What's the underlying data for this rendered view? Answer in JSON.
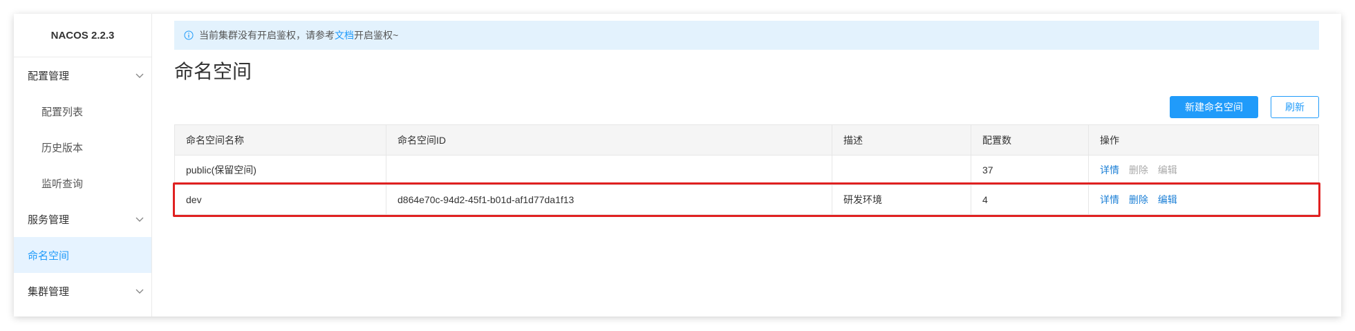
{
  "app": {
    "brand": "NACOS 2.2.3"
  },
  "sidebar": {
    "items": [
      {
        "label": "配置管理",
        "type": "group"
      },
      {
        "label": "配置列表",
        "type": "sub"
      },
      {
        "label": "历史版本",
        "type": "sub"
      },
      {
        "label": "监听查询",
        "type": "sub"
      },
      {
        "label": "服务管理",
        "type": "group"
      },
      {
        "label": "命名空间",
        "type": "active"
      },
      {
        "label": "集群管理",
        "type": "group"
      }
    ]
  },
  "notice": {
    "prefix": "当前集群没有开启鉴权，请参考",
    "link": "文档",
    "suffix": "开启鉴权~"
  },
  "page": {
    "title": "命名空间"
  },
  "toolbar": {
    "create_label": "新建命名空间",
    "refresh_label": "刷新"
  },
  "table": {
    "headers": [
      "命名空间名称",
      "命名空间ID",
      "描述",
      "配置数",
      "操作"
    ],
    "rows": [
      {
        "name": "public(保留空间)",
        "id": "",
        "desc": "",
        "count": "37",
        "ops": [
          "详情",
          "删除",
          "编辑"
        ]
      },
      {
        "name": "dev",
        "id": "d864e70c-94d2-45f1-b01d-af1d77da1f13",
        "desc": "研发环境",
        "count": "4",
        "ops": [
          "详情",
          "删除",
          "编辑"
        ]
      }
    ]
  },
  "colors": {
    "accent": "#209bfa",
    "highlight": "#e02020",
    "notice_bg": "#e3f2fd"
  }
}
